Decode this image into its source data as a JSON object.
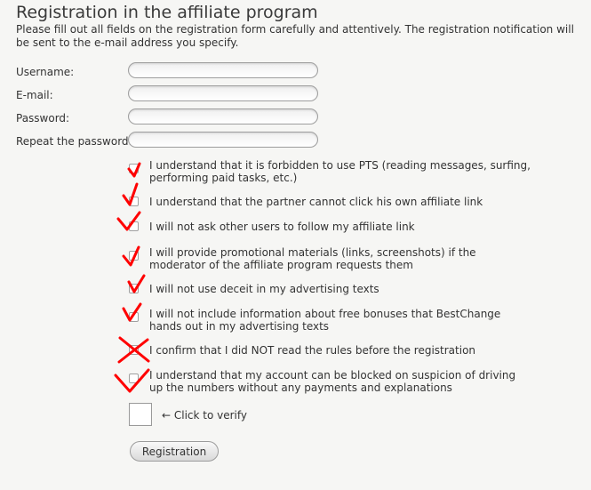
{
  "page": {
    "title": "Registration in the affiliate program",
    "intro": "Please fill out all fields on the registration form carefully and attentively. The registration notification will be sent to the e-mail address you specify."
  },
  "form": {
    "fields": [
      {
        "label": "Username:",
        "value": ""
      },
      {
        "label": "E-mail:",
        "value": ""
      },
      {
        "label": "Password:",
        "value": ""
      },
      {
        "label": "Repeat the password:",
        "value": ""
      }
    ],
    "checkboxes": [
      {
        "text": "I understand that it is forbidden to use PTS (reading messages, surfing, performing paid tasks, etc.)",
        "handwritten_mark": "check"
      },
      {
        "text": "I understand that the partner cannot click his own affiliate link",
        "handwritten_mark": "check"
      },
      {
        "text": "I will not ask other users to follow my affiliate link",
        "handwritten_mark": "check"
      },
      {
        "text": "I will provide promotional materials (links, screenshots) if the moderator of the affiliate program requests them",
        "handwritten_mark": "check"
      },
      {
        "text": "I will not use deceit in my advertising texts",
        "handwritten_mark": "check"
      },
      {
        "text": "I will not include information about free bonuses that BestChange hands out in my advertising texts",
        "handwritten_mark": "check"
      },
      {
        "text": "I confirm that I did NOT read the rules before the registration",
        "handwritten_mark": "cross"
      },
      {
        "text": "I understand that my account can be blocked on suspicion of driving up the numbers without any payments and explanations",
        "handwritten_mark": "check"
      }
    ],
    "verify_label": "← Click to verify",
    "submit_label": "Registration"
  },
  "colors": {
    "background": "#f6f6f4",
    "annotation_mark": "#ff0000"
  }
}
